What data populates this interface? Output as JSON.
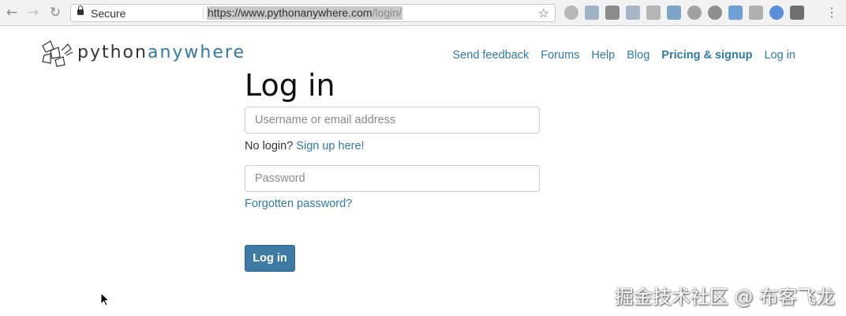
{
  "browser": {
    "secure_label": "Secure",
    "url_host": "https://www.pythonanywhere.com",
    "url_path": "/login/",
    "extensions": [
      "extension-1-icon",
      "extension-2-icon",
      "extension-3-icon",
      "extension-4-icon",
      "extension-5-icon",
      "extension-6-icon",
      "extension-7-icon",
      "extension-8-icon",
      "extension-9-icon",
      "extension-10-icon",
      "extension-11-icon",
      "extension-12-icon"
    ]
  },
  "header": {
    "logo_python": "python",
    "logo_anywhere": "anywhere",
    "nav": [
      "Send feedback",
      "Forums",
      "Help",
      "Blog",
      "Pricing & signup",
      "Log in"
    ]
  },
  "form": {
    "title": "Log in",
    "username_placeholder": "Username or email address",
    "username_value": "",
    "no_login_text": "No login?",
    "signup_link": "Sign up here!",
    "password_placeholder": "Password",
    "password_value": "",
    "forgot_link": "Forgotten password?",
    "submit_label": "Log in"
  },
  "watermark": "掘金技术社区 @ 布客飞龙",
  "colors": {
    "link": "#2f7aa9",
    "button": "#3e7ba4"
  }
}
